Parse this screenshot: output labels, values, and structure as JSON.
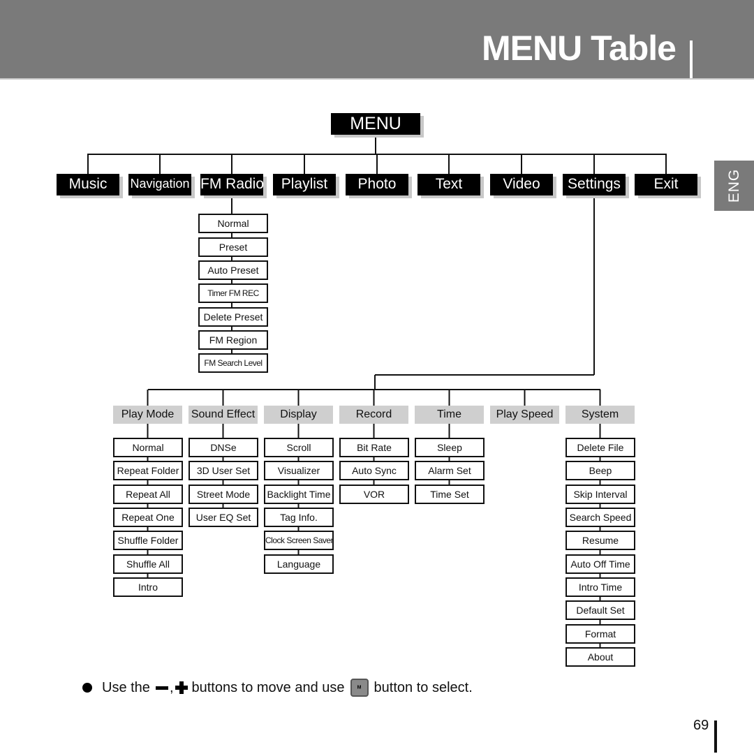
{
  "header": {
    "title": "MENU Table"
  },
  "language_tab": "ENG",
  "root": "MENU",
  "top_menu": [
    "Music",
    "Navigation",
    "FM Radio",
    "Playlist",
    "Photo",
    "Text",
    "Video",
    "Settings",
    "Exit"
  ],
  "fm_radio_items": [
    "Normal",
    "Preset",
    "Auto Preset",
    "Timer FM REC",
    "Delete Preset",
    "FM Region",
    "FM Search Level"
  ],
  "settings_categories": [
    {
      "label": "Play Mode",
      "items": [
        "Normal",
        "Repeat Folder",
        "Repeat All",
        "Repeat One",
        "Shuffle Folder",
        "Shuffle All",
        "Intro"
      ]
    },
    {
      "label": "Sound Effect",
      "items": [
        "DNSe",
        "3D User Set",
        "Street Mode",
        "User EQ Set"
      ]
    },
    {
      "label": "Display",
      "items": [
        "Scroll",
        "Visualizer",
        "Backlight Time",
        "Tag Info.",
        "Clock Screen Saver",
        "Language"
      ]
    },
    {
      "label": "Record",
      "items": [
        "Bit Rate",
        "Auto Sync",
        "VOR"
      ]
    },
    {
      "label": "Time",
      "items": [
        "Sleep",
        "Alarm Set",
        "Time Set"
      ]
    },
    {
      "label": "Play Speed",
      "items": []
    },
    {
      "label": "System",
      "items": [
        "Delete File",
        "Beep",
        "Skip Interval",
        "Search Speed",
        "Resume",
        "Auto Off Time",
        "Intro Time",
        "Default Set",
        "Format",
        "About"
      ]
    }
  ],
  "instruction": {
    "part1": "Use the",
    "sep": ",",
    "part2": "buttons to move and use",
    "button_label": "M",
    "part3": "button to select."
  },
  "page_number": "69"
}
